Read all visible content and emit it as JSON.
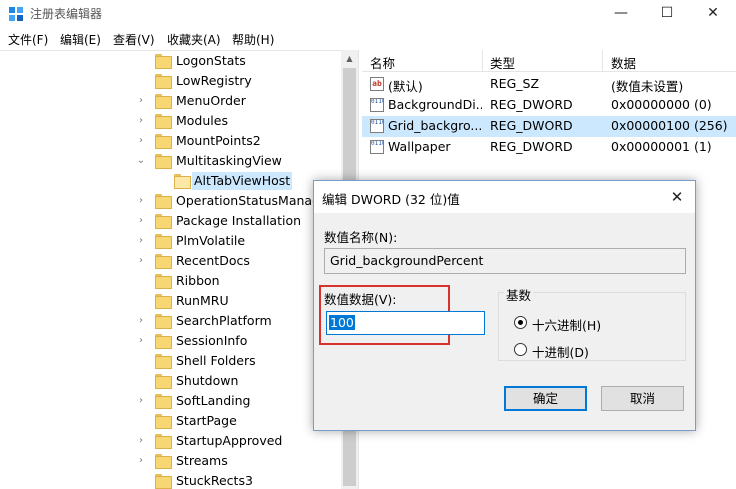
{
  "window": {
    "title": "注册表编辑器",
    "minimize": "—",
    "maximize": "☐",
    "close": "✕"
  },
  "menu": [
    "文件(F)",
    "编辑(E)",
    "查看(V)",
    "收藏夹(A)",
    "帮助(H)"
  ],
  "tree": {
    "items": [
      {
        "label": "LogonStats",
        "expander": ""
      },
      {
        "label": "LowRegistry",
        "expander": ""
      },
      {
        "label": "MenuOrder",
        "expander": "›"
      },
      {
        "label": "Modules",
        "expander": "›"
      },
      {
        "label": "MountPoints2",
        "expander": "›"
      },
      {
        "label": "MultitaskingView",
        "expander": "⌄"
      },
      {
        "label": "AltTabViewHost",
        "expander": ""
      },
      {
        "label": "OperationStatusManag",
        "expander": "›"
      },
      {
        "label": "Package Installation",
        "expander": "›"
      },
      {
        "label": "PlmVolatile",
        "expander": "›"
      },
      {
        "label": "RecentDocs",
        "expander": "›"
      },
      {
        "label": "Ribbon",
        "expander": ""
      },
      {
        "label": "RunMRU",
        "expander": ""
      },
      {
        "label": "SearchPlatform",
        "expander": "›"
      },
      {
        "label": "SessionInfo",
        "expander": "›"
      },
      {
        "label": "Shell Folders",
        "expander": ""
      },
      {
        "label": "Shutdown",
        "expander": ""
      },
      {
        "label": "SoftLanding",
        "expander": "›"
      },
      {
        "label": "StartPage",
        "expander": ""
      },
      {
        "label": "StartupApproved",
        "expander": "›"
      },
      {
        "label": "Streams",
        "expander": "›"
      },
      {
        "label": "StuckRects3",
        "expander": ""
      }
    ]
  },
  "list": {
    "headers": {
      "name": "名称",
      "type": "类型",
      "data": "数据"
    },
    "rows": [
      {
        "icon": "ab",
        "name": "(默认)",
        "type": "REG_SZ",
        "data": "(数值未设置)"
      },
      {
        "icon": "0110",
        "name": "BackgroundDi...",
        "type": "REG_DWORD",
        "data": "0x00000000 (0)"
      },
      {
        "icon": "0110",
        "name": "Grid_backgro...",
        "type": "REG_DWORD",
        "data": "0x00000100 (256)"
      },
      {
        "icon": "0110",
        "name": "Wallpaper",
        "type": "REG_DWORD",
        "data": "0x00000001 (1)"
      }
    ]
  },
  "dialog": {
    "title": "编辑 DWORD (32 位)值",
    "close": "✕",
    "name_label": "数值名称(N):",
    "name_value": "Grid_backgroundPercent",
    "data_label": "数值数据(V):",
    "data_value": "100",
    "base_title": "基数",
    "radio_hex": "十六进制(H)",
    "radio_dec": "十进制(D)",
    "ok": "确定",
    "cancel": "取消"
  },
  "colors": {
    "selection": "#cce8ff",
    "accent": "#0078d7",
    "highlight_box": "#d6322e"
  }
}
